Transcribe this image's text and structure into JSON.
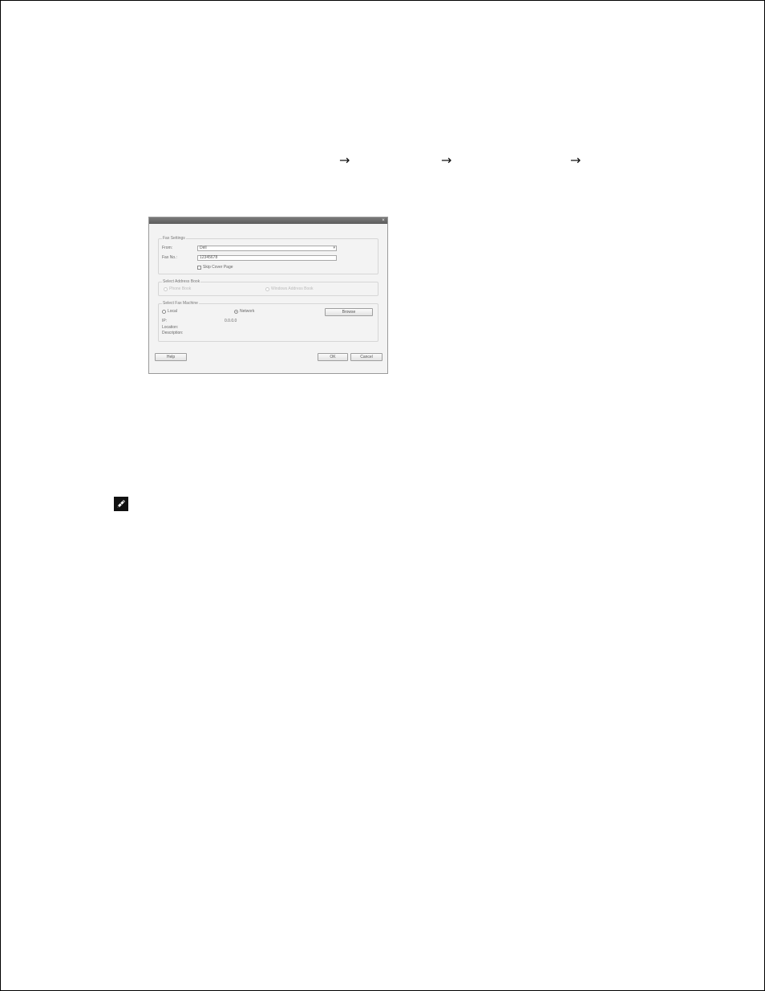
{
  "nav_arrows": [
    "→",
    "→",
    "→"
  ],
  "dialog": {
    "title": "",
    "close_glyph": "×",
    "fax_settings": {
      "group_label": "Fax Settings",
      "from_label": "From:",
      "from_value": "Dell",
      "faxno_label": "Fax No.:",
      "faxno_value": "12345678",
      "skip_cover_label": "Skip Cover Page"
    },
    "address_book": {
      "group_label": "Select Address Book",
      "option1": "Phone Book",
      "option2": "Windows Address Book"
    },
    "fax_machine": {
      "group_label": "Select Fax Machine",
      "local_label": "Local",
      "network_label": "Network",
      "browse_label": "Browse",
      "ip_label": "IP:",
      "ip_value": "0.0.0.0",
      "location_label": "Location:",
      "description_label": "Description:"
    },
    "buttons": {
      "help": "Help",
      "ok": "OK",
      "cancel": "Cancel"
    }
  },
  "note_icon": "pencil-note-icon"
}
